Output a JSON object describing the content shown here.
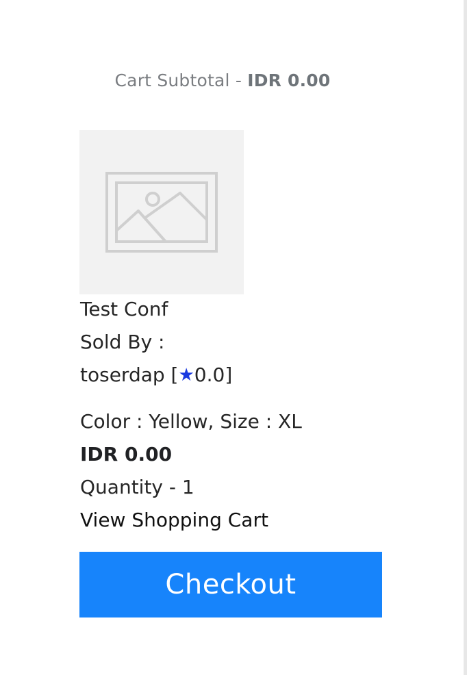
{
  "cart": {
    "subtotal_label": "Cart Subtotal - ",
    "subtotal_amount": "IDR 0.00"
  },
  "item": {
    "image_icon": "image-placeholder-icon",
    "name": "Test Conf",
    "sold_by_label": "Sold By :",
    "seller_name": "toserdap",
    "rating_open": " [",
    "rating_icon": "star-icon",
    "rating_value": "0.0",
    "rating_close": "]",
    "variant": "Color : Yellow, Size : XL",
    "price": "IDR 0.00",
    "quantity": "Quantity - 1"
  },
  "actions": {
    "view_cart_label": "View Shopping Cart",
    "checkout_label": "Checkout"
  },
  "colors": {
    "accent": "#1784fb",
    "star": "#1a3ae0",
    "muted_text": "#7a7d81",
    "placeholder_bg": "#f2f2f2"
  }
}
